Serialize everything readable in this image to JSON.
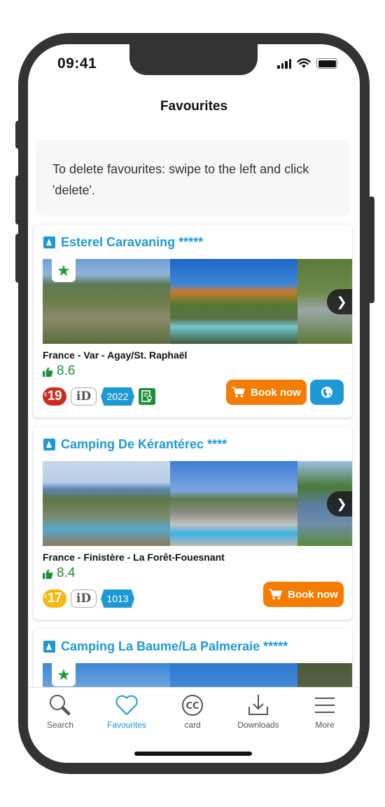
{
  "status_bar": {
    "time": "09:41"
  },
  "header": {
    "title": "Favourites"
  },
  "info": {
    "text": "To delete favourites: swipe to the left and click 'delete'."
  },
  "colors": {
    "accent": "#1d9ad6",
    "book_button": "#f57c00",
    "rating_green": "#1e8e3a",
    "price_red": "#cc2c1e",
    "price_yellow": "#f6b910"
  },
  "favourites": [
    {
      "name": "Esterel Caravaning *****",
      "has_star_badge": true,
      "location": "France  - Var - Agay/St. Raphaël",
      "rating": "8.6",
      "price": "19",
      "price_currency": "€",
      "id_badge": "iD",
      "year_badge": "2022",
      "has_certificate_badge": true,
      "book_label": "Book now",
      "has_website_button": true
    },
    {
      "name": "Camping De Kérantérec ****",
      "has_star_badge": false,
      "location": "France  - Finistère - La Forêt-Fouesnant",
      "rating": "8.4",
      "price": "17",
      "price_currency": "€",
      "id_badge": "iD",
      "year_badge": "1013",
      "has_certificate_badge": false,
      "book_label": "Book now",
      "has_website_button": false
    },
    {
      "name": "Camping La Baume/La Palmeraie *****",
      "has_star_badge": true
    }
  ],
  "tab_bar": {
    "items": [
      {
        "label": "Search",
        "icon": "search-icon",
        "active": false
      },
      {
        "label": "Favourites",
        "icon": "heart-icon",
        "active": true
      },
      {
        "label": "card",
        "icon": "cc-card-icon",
        "active": false
      },
      {
        "label": "Downloads",
        "icon": "download-icon",
        "active": false
      },
      {
        "label": "More",
        "icon": "menu-icon",
        "active": false
      }
    ]
  }
}
